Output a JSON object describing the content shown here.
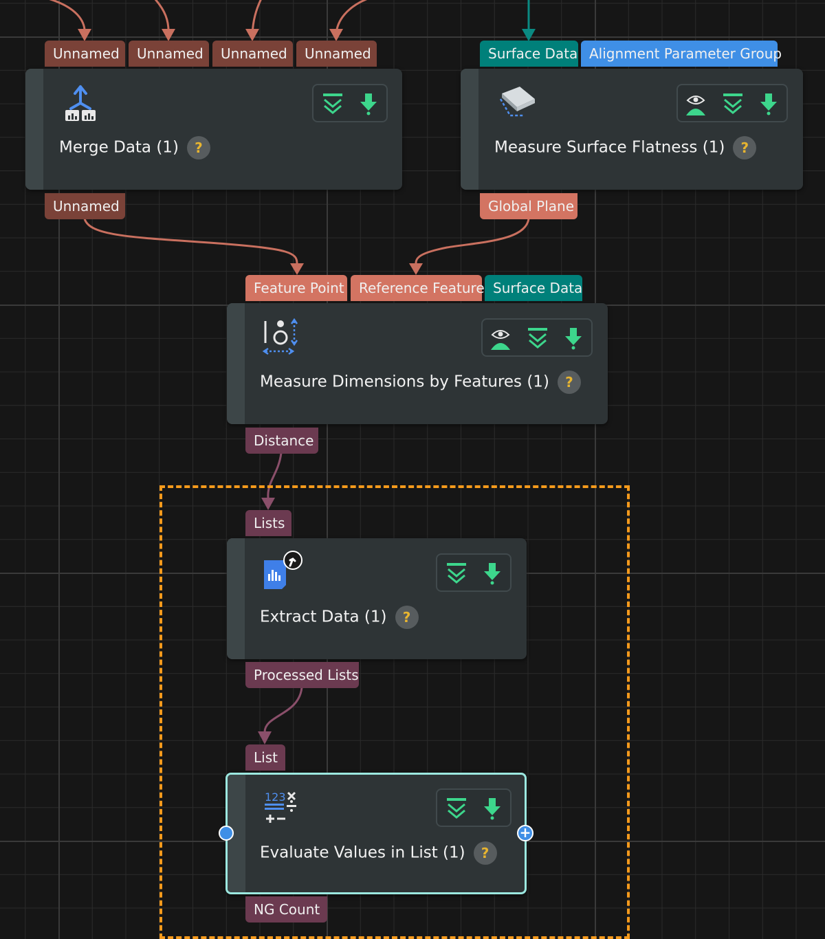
{
  "nodes": {
    "merge": {
      "title": "Merge Data (1)",
      "inputs": [
        "Unnamed",
        "Unnamed",
        "Unnamed",
        "Unnamed"
      ],
      "output": "Unnamed",
      "icon": "merge-data-icon"
    },
    "flatness": {
      "title": "Measure Surface Flatness (1)",
      "inputs": [
        "Surface Data",
        "Alignment Parameter Group"
      ],
      "output": "Global Plane",
      "icon": "surface-flatness-icon"
    },
    "dimensions": {
      "title": "Measure Dimensions by Features (1)",
      "inputs": [
        "Feature Point",
        "Reference Feature",
        "Surface Data"
      ],
      "output": "Distance",
      "icon": "measure-dimensions-icon"
    },
    "extract": {
      "title": "Extract Data (1)",
      "inputs": [
        "Lists"
      ],
      "output": "Processed Lists",
      "icon": "extract-data-icon"
    },
    "evaluate": {
      "title": "Evaluate Values in List (1)",
      "inputs": [
        "List"
      ],
      "output": "NG Count",
      "icon": "evaluate-values-icon"
    }
  },
  "help_glyph": "?",
  "add_glyph": "+",
  "colors": {
    "grid_bg": "#161616",
    "node_bg": "#2e3436",
    "selection_frame": "#f59a1c",
    "selected_border": "#9ce8e0",
    "wire_salmon": "#c9705f",
    "wire_teal": "#0a8a82",
    "wire_plum": "#8a4f6a"
  }
}
